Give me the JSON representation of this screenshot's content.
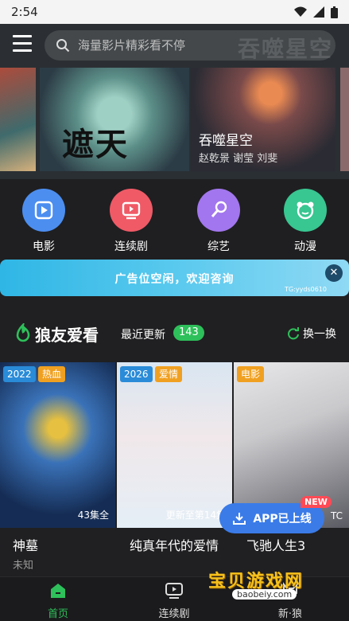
{
  "status": {
    "time": "2:54"
  },
  "search": {
    "placeholder": "海量影片精彩看不停"
  },
  "banner": {
    "poster_calligraphy": "遮天",
    "logo": "吞噬星空",
    "title": "吞噬星空",
    "cast": "赵乾景 谢莹 刘斐"
  },
  "categories": [
    {
      "label": "电影",
      "color": "#4c8ef0"
    },
    {
      "label": "连续剧",
      "color": "#ef5a66"
    },
    {
      "label": "综艺",
      "color": "#a276ee"
    },
    {
      "label": "动漫",
      "color": "#38c691"
    }
  ],
  "ad": {
    "text": "广告位空闲，欢迎咨询",
    "contact": "TG:yyds0610",
    "close": "✕"
  },
  "section": {
    "title": "狼友爱看",
    "recent_label": "最近更新",
    "recent_count": "143",
    "refresh_label": "换一换"
  },
  "cards": [
    {
      "year": "2022",
      "genre": "热血",
      "overlay": "43集全",
      "name": "神墓",
      "sub": "未知"
    },
    {
      "year": "2026",
      "genre": "爱情",
      "overlay": "更新至第14集",
      "name": "纯真年代的爱情",
      "sub": ""
    },
    {
      "year": "",
      "genre": "电影",
      "overlay": "TC",
      "name": "飞驰人生3",
      "sub": ""
    }
  ],
  "app_button": {
    "label": "APP已上线",
    "badge": "NEW"
  },
  "tabs": [
    {
      "label": "首页",
      "active": true
    },
    {
      "label": "连续剧",
      "active": false
    },
    {
      "label": "新·狼",
      "active": false
    }
  ],
  "watermark": {
    "name": "宝贝游戏网",
    "url": "baobeiy.com"
  }
}
